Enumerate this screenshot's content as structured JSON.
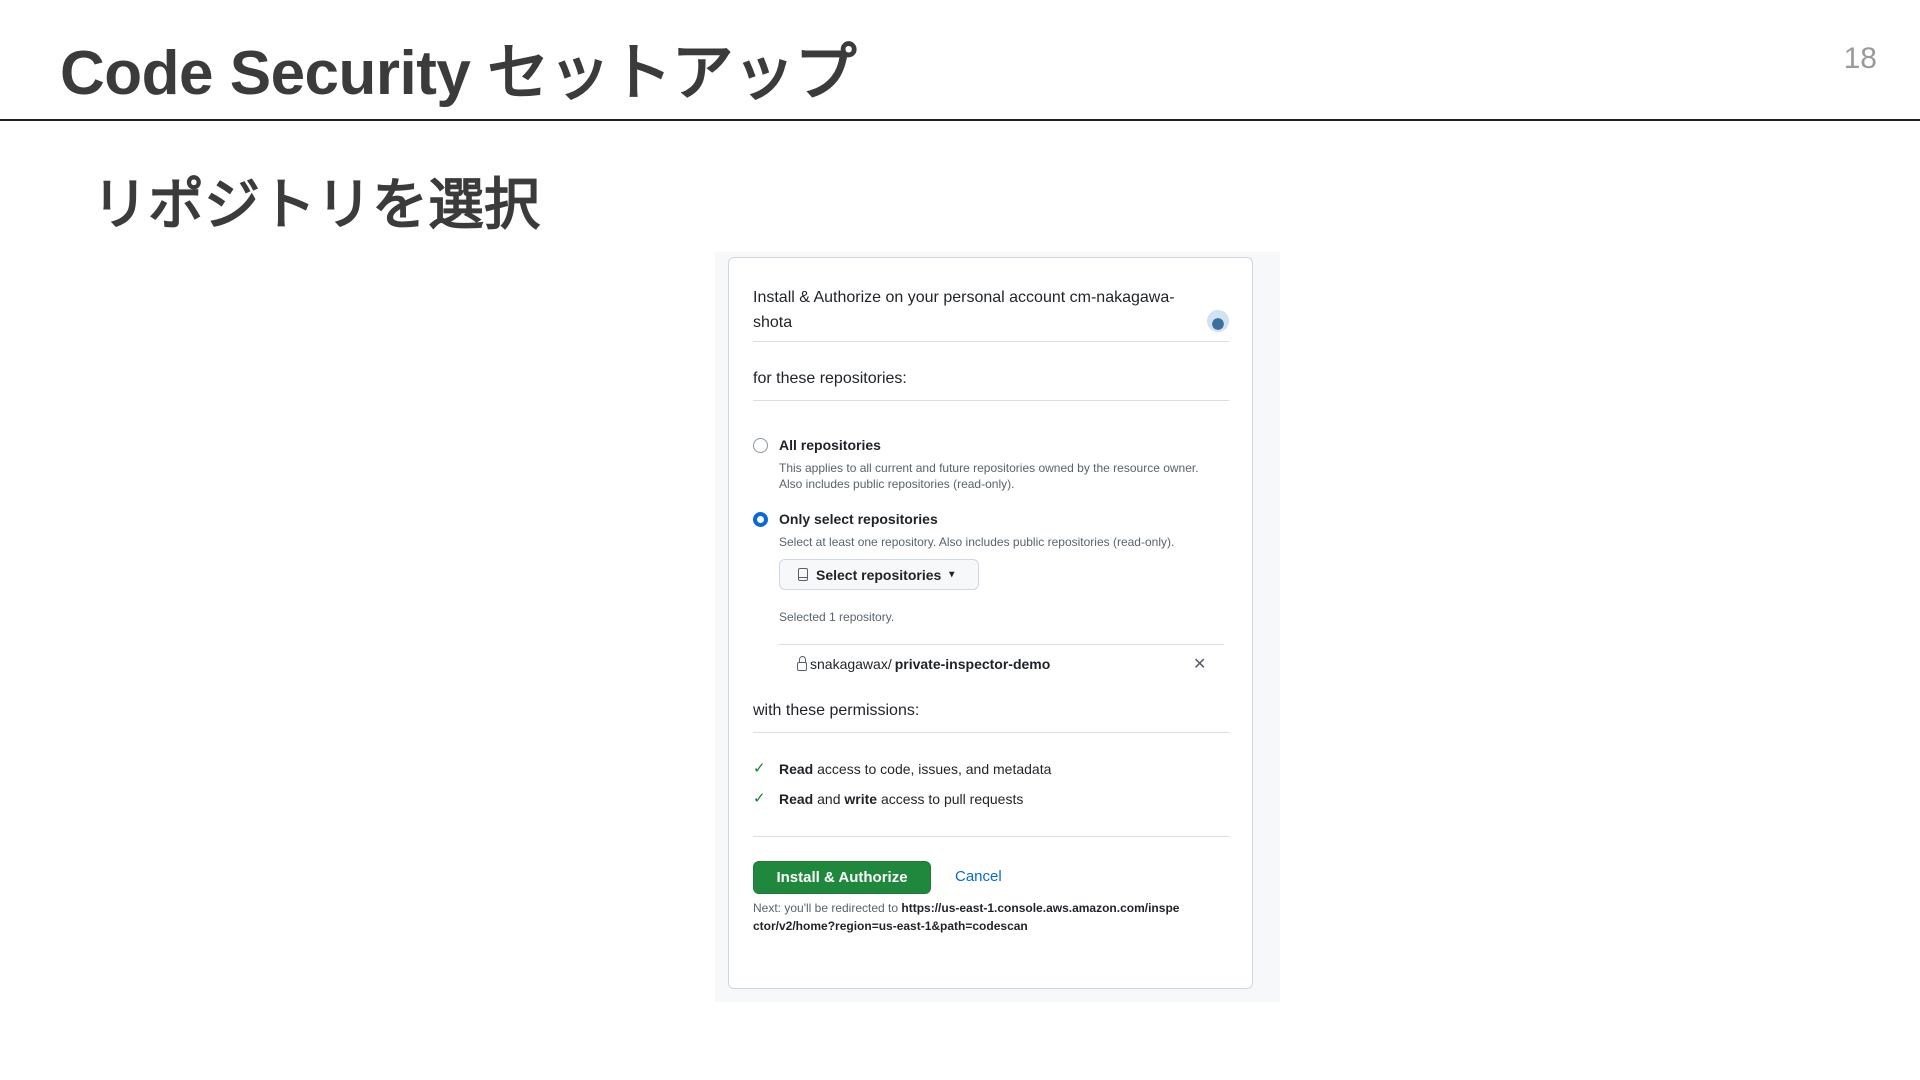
{
  "slide": {
    "title": "Code Security セットアップ",
    "page_number": "18",
    "section_heading": "リポジトリを選択"
  },
  "dialog": {
    "install_heading": "Install & Authorize on your personal account cm-nakagawa-shota",
    "repositories_label": "for these repositories:",
    "options": [
      {
        "title": "All repositories",
        "description": "This applies to all current and future repositories owned by the resource owner. Also includes public repositories (read-only).",
        "selected": false
      },
      {
        "title": "Only select repositories",
        "description": "Select at least one repository. Also includes public repositories (read-only).",
        "selected": true
      }
    ],
    "select_button_label": "Select repositories",
    "selected_count_text": "Selected 1 repository.",
    "selected_repo": {
      "owner": "snakagawax/",
      "name": "private-inspector-demo"
    },
    "permissions_label": "with these permissions:",
    "permissions": [
      {
        "bold1": "Read",
        "text1": " access to code, issues, and metadata",
        "bold2": "",
        "text2": ""
      },
      {
        "bold1": "Read",
        "text1": " and ",
        "bold2": "write",
        "text2": " access to pull requests"
      }
    ],
    "install_button_label": "Install & Authorize",
    "cancel_label": "Cancel",
    "redirect_prefix": "Next: you'll be redirected to ",
    "redirect_url": "https://us-east-1.console.aws.amazon.com/inspector/v2/home?region=us-east-1&path=codescan"
  },
  "icons": {
    "radio": "radio-icon",
    "repo": "repo-icon",
    "lock": "lock-icon",
    "remove": "x-icon",
    "check": "check-icon"
  },
  "colors": {
    "primary_button": "#1f883d",
    "link": "#0969da",
    "check": "#1a7f37",
    "radio_selected": "#0969da"
  }
}
